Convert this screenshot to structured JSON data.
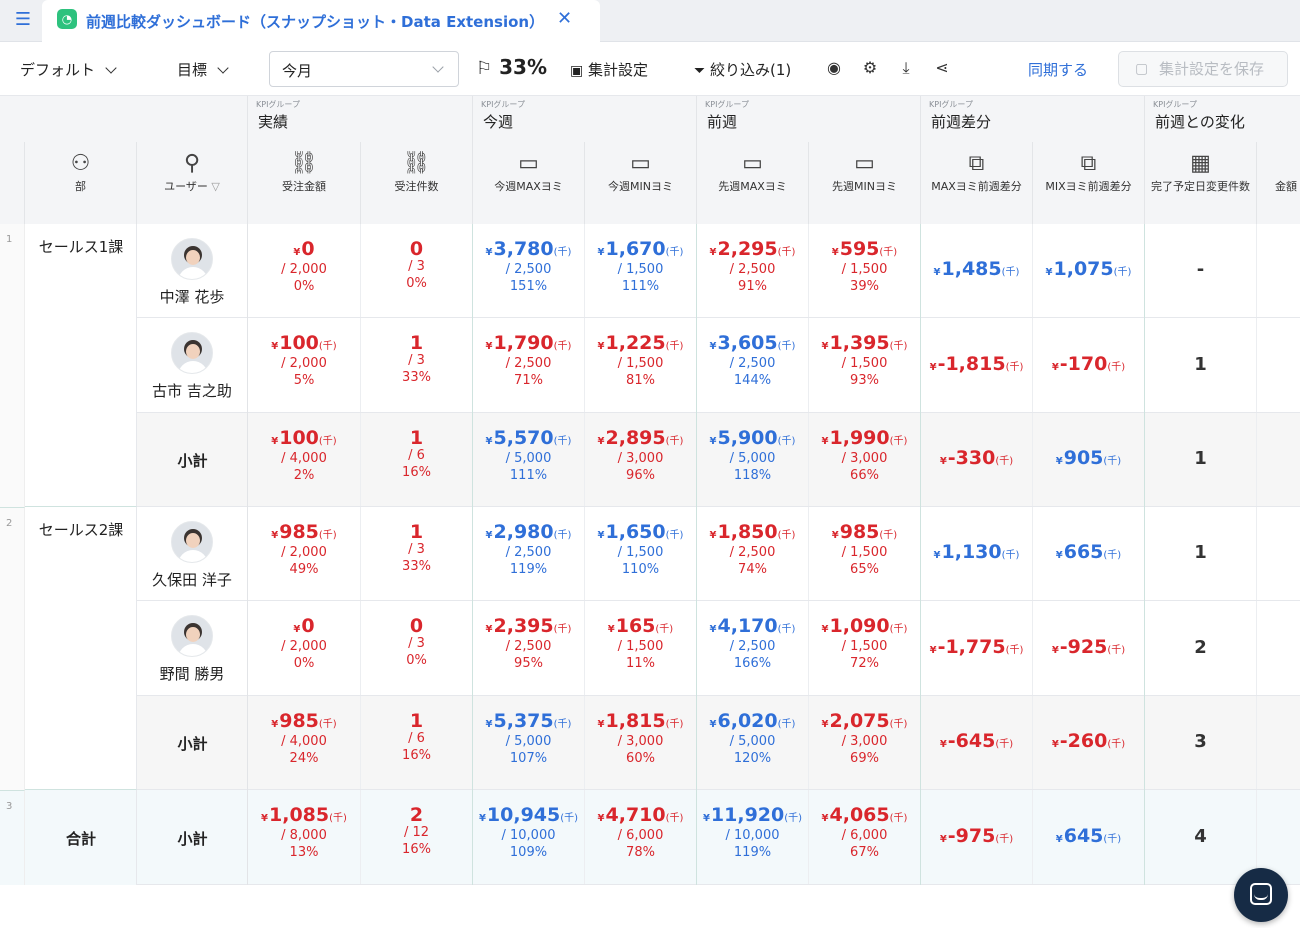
{
  "tab": {
    "title": "前週比較ダッシュボード（スナップショット・Data Extension）"
  },
  "toolbar": {
    "view": "デフォルト",
    "target": "目標",
    "period": "今月",
    "progress": "33%",
    "agg_settings": "集計設定",
    "filter": "絞り込み(1)",
    "sync": "同期する",
    "save": "集計設定を保存"
  },
  "groups": [
    {
      "k": "KPIグループ",
      "n": "実績"
    },
    {
      "k": "KPIグループ",
      "n": "今週"
    },
    {
      "k": "KPIグループ",
      "n": "前週"
    },
    {
      "k": "KPIグループ",
      "n": "前週差分"
    },
    {
      "k": "KPIグループ",
      "n": "前週との変化"
    }
  ],
  "cols": {
    "dept": "部",
    "user": "ユーザー",
    "c1": "受注金額",
    "c2": "受注件数",
    "c3": "今週MAXヨミ",
    "c4": "今週MINヨミ",
    "c5": "先週MAXヨミ",
    "c6": "先週MINヨミ",
    "c7": "MAXヨミ前週差分",
    "c8": "MIXヨミ前週差分",
    "c9": "完了予定日変更件数",
    "c10": "金額"
  },
  "units": {
    "yen": "¥",
    "k": "(千)"
  },
  "rows": [
    {
      "num": "1",
      "dept": "セールス1課",
      "user": "中澤 花歩",
      "c1": {
        "v": "0",
        "t": "/ 2,000",
        "p": "0%"
      },
      "c2": {
        "v": "0",
        "t": "/ 3",
        "p": "0%"
      },
      "c3": {
        "v": "3,780",
        "t": "/ 2,500",
        "p": "151%"
      },
      "c4": {
        "v": "1,670",
        "t": "/ 1,500",
        "p": "111%"
      },
      "c5": {
        "v": "2,295",
        "t": "/ 2,500",
        "p": "91%"
      },
      "c6": {
        "v": "595",
        "t": "/ 1,500",
        "p": "39%"
      },
      "d1": "1,485",
      "d2": "1,075",
      "cnt": "-"
    },
    {
      "user": "古市 吉之助",
      "c1": {
        "v": "100",
        "t": "/ 2,000",
        "p": "5%"
      },
      "c2": {
        "v": "1",
        "t": "/ 3",
        "p": "33%"
      },
      "c3": {
        "v": "1,790",
        "t": "/ 2,500",
        "p": "71%"
      },
      "c4": {
        "v": "1,225",
        "t": "/ 1,500",
        "p": "81%"
      },
      "c5": {
        "v": "3,605",
        "t": "/ 2,500",
        "p": "144%"
      },
      "c6": {
        "v": "1,395",
        "t": "/ 1,500",
        "p": "93%"
      },
      "d1": "-1,815",
      "d2": "-170",
      "cnt": "1"
    },
    {
      "user": "小計",
      "c1": {
        "v": "100",
        "t": "/ 4,000",
        "p": "2%"
      },
      "c2": {
        "v": "1",
        "t": "/ 6",
        "p": "16%"
      },
      "c3": {
        "v": "5,570",
        "t": "/ 5,000",
        "p": "111%"
      },
      "c4": {
        "v": "2,895",
        "t": "/ 3,000",
        "p": "96%"
      },
      "c5": {
        "v": "5,900",
        "t": "/ 5,000",
        "p": "118%"
      },
      "c6": {
        "v": "1,990",
        "t": "/ 3,000",
        "p": "66%"
      },
      "d1": "-330",
      "d2": "905",
      "cnt": "1"
    },
    {
      "num": "2",
      "dept": "セールス2課",
      "user": "久保田 洋子",
      "c1": {
        "v": "985",
        "t": "/ 2,000",
        "p": "49%"
      },
      "c2": {
        "v": "1",
        "t": "/ 3",
        "p": "33%"
      },
      "c3": {
        "v": "2,980",
        "t": "/ 2,500",
        "p": "119%"
      },
      "c4": {
        "v": "1,650",
        "t": "/ 1,500",
        "p": "110%"
      },
      "c5": {
        "v": "1,850",
        "t": "/ 2,500",
        "p": "74%"
      },
      "c6": {
        "v": "985",
        "t": "/ 1,500",
        "p": "65%"
      },
      "d1": "1,130",
      "d2": "665",
      "cnt": "1"
    },
    {
      "user": "野間 勝男",
      "c1": {
        "v": "0",
        "t": "/ 2,000",
        "p": "0%"
      },
      "c2": {
        "v": "0",
        "t": "/ 3",
        "p": "0%"
      },
      "c3": {
        "v": "2,395",
        "t": "/ 2,500",
        "p": "95%"
      },
      "c4": {
        "v": "165",
        "t": "/ 1,500",
        "p": "11%"
      },
      "c5": {
        "v": "4,170",
        "t": "/ 2,500",
        "p": "166%"
      },
      "c6": {
        "v": "1,090",
        "t": "/ 1,500",
        "p": "72%"
      },
      "d1": "-1,775",
      "d2": "-925",
      "cnt": "2"
    },
    {
      "user": "小計",
      "c1": {
        "v": "985",
        "t": "/ 4,000",
        "p": "24%"
      },
      "c2": {
        "v": "1",
        "t": "/ 6",
        "p": "16%"
      },
      "c3": {
        "v": "5,375",
        "t": "/ 5,000",
        "p": "107%"
      },
      "c4": {
        "v": "1,815",
        "t": "/ 3,000",
        "p": "60%"
      },
      "c5": {
        "v": "6,020",
        "t": "/ 5,000",
        "p": "120%"
      },
      "c6": {
        "v": "2,075",
        "t": "/ 3,000",
        "p": "69%"
      },
      "d1": "-645",
      "d2": "-260",
      "cnt": "3"
    },
    {
      "num": "3",
      "dept": "合計",
      "user": "小計",
      "c1": {
        "v": "1,085",
        "t": "/ 8,000",
        "p": "13%"
      },
      "c2": {
        "v": "2",
        "t": "/ 12",
        "p": "16%"
      },
      "c3": {
        "v": "10,945",
        "t": "/ 10,000",
        "p": "109%"
      },
      "c4": {
        "v": "4,710",
        "t": "/ 6,000",
        "p": "78%"
      },
      "c5": {
        "v": "11,920",
        "t": "/ 10,000",
        "p": "119%"
      },
      "c6": {
        "v": "4,065",
        "t": "/ 6,000",
        "p": "67%"
      },
      "d1": "-975",
      "d2": "645",
      "cnt": "4"
    }
  ]
}
